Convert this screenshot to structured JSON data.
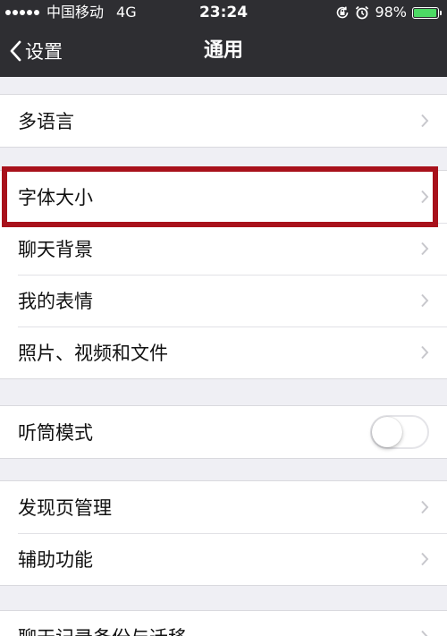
{
  "status_bar": {
    "carrier": "中国移动",
    "network": "4G",
    "time": "23:24",
    "battery_percent": "98%",
    "battery_level": 0.98,
    "battery_color": "#4cd964",
    "icons": [
      "signal-icon",
      "orientation-lock-icon",
      "alarm-icon",
      "battery-icon"
    ]
  },
  "nav": {
    "back_label": "设置",
    "title": "通用",
    "back_icon": "chevron-left-icon",
    "background_color": "#2e2e32"
  },
  "groups": [
    {
      "items": [
        {
          "label": "多语言",
          "accessory": "chevron-right-icon"
        }
      ]
    },
    {
      "items": [
        {
          "label": "字体大小",
          "accessory": "chevron-right-icon",
          "highlighted": true
        },
        {
          "label": "聊天背景",
          "accessory": "chevron-right-icon"
        },
        {
          "label": "我的表情",
          "accessory": "chevron-right-icon"
        },
        {
          "label": "照片、视频和文件",
          "accessory": "chevron-right-icon"
        }
      ]
    },
    {
      "items": [
        {
          "label": "听筒模式",
          "accessory": "toggle",
          "toggle_on": false
        }
      ]
    },
    {
      "items": [
        {
          "label": "发现页管理",
          "accessory": "chevron-right-icon"
        },
        {
          "label": "辅助功能",
          "accessory": "chevron-right-icon"
        }
      ]
    },
    {
      "items": [
        {
          "label": "聊天记录备份与迁移",
          "accessory": "chevron-right-icon"
        }
      ]
    }
  ],
  "highlight_color": "#a8111b"
}
